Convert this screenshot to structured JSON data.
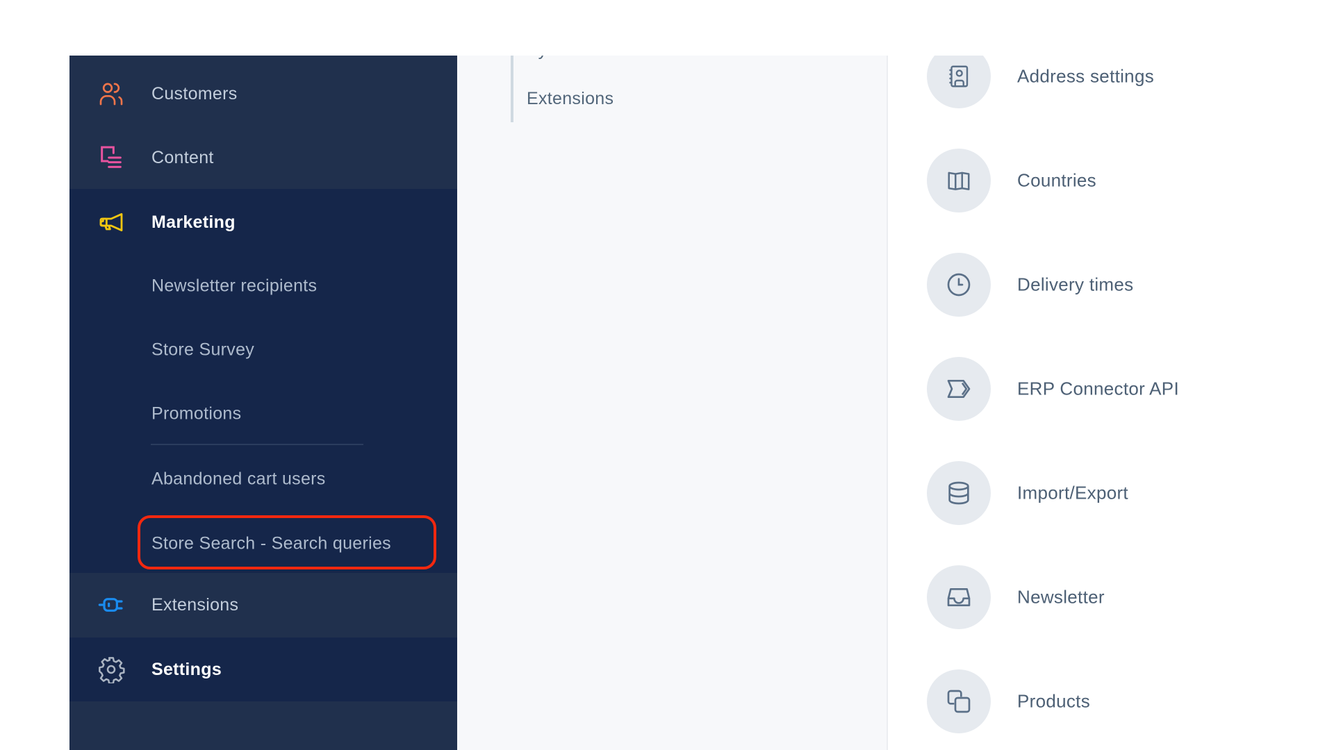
{
  "sidebar": {
    "items": [
      {
        "label": "Customers",
        "icon": "users-icon",
        "color": "#f0754a"
      },
      {
        "label": "Content",
        "icon": "content-list-icon",
        "color": "#e8539f"
      },
      {
        "label": "Marketing",
        "icon": "megaphone-icon",
        "color": "#f2c611"
      },
      {
        "label": "Extensions",
        "icon": "plug-icon",
        "color": "#1a8cf0"
      },
      {
        "label": "Settings",
        "icon": "gear-icon",
        "color": "#aab4c2"
      }
    ],
    "marketing_children": [
      "Newsletter recipients",
      "Store Survey",
      "Promotions",
      "Abandoned cart users",
      "Store Search - Search queries"
    ],
    "highlight_color": "#f2280f"
  },
  "middle": {
    "cut_item": "System",
    "items": [
      "Extensions"
    ]
  },
  "settings_list": [
    {
      "label": "Address settings",
      "icon": "address-book-icon"
    },
    {
      "label": "Countries",
      "icon": "map-icon"
    },
    {
      "label": "Delivery times",
      "icon": "clock-icon"
    },
    {
      "label": "ERP Connector API",
      "icon": "connector-icon"
    },
    {
      "label": "Import/Export",
      "icon": "database-icon"
    },
    {
      "label": "Newsletter",
      "icon": "inbox-icon"
    },
    {
      "label": "Products",
      "icon": "copy-icon"
    }
  ]
}
